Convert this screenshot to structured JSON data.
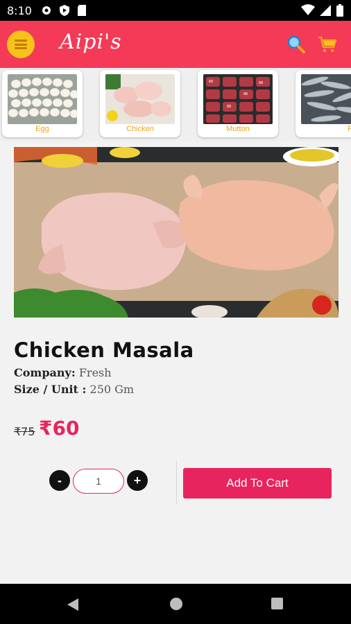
{
  "status_bar": {
    "time": "8:10",
    "left_icons": [
      "settings-icon",
      "play-protect-icon",
      "sd-card-icon"
    ],
    "right_icons": [
      "wifi-icon",
      "signal-icon",
      "battery-icon"
    ]
  },
  "app_bar": {
    "brand": "Aipi's",
    "menu_icon": "hamburger-icon",
    "search_icon": "search-icon",
    "cart_icon": "cart-icon",
    "color": "#f43a57"
  },
  "categories": [
    {
      "label": "Egg"
    },
    {
      "label": "Chicken"
    },
    {
      "label": "Mutton"
    },
    {
      "label": "Fish"
    }
  ],
  "product": {
    "name": "Chicken Masala",
    "company_label": "Company:",
    "company_value": "Fresh",
    "size_label": "Size / Unit :",
    "size_value": "250 Gm",
    "old_price": "₹75",
    "price": "₹60"
  },
  "quantity": {
    "minus": "-",
    "value": "1",
    "plus": "+"
  },
  "actions": {
    "add_to_cart": "Add To Cart"
  },
  "colors": {
    "accent": "#e8245e",
    "category_label": "#f2a31b"
  }
}
